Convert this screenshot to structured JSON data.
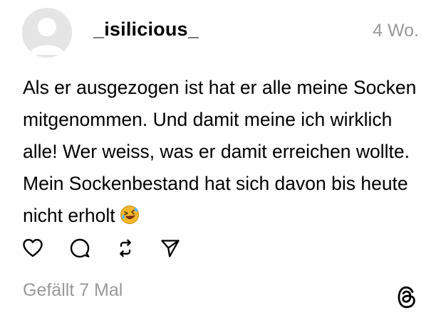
{
  "post": {
    "username": "_isilicious_",
    "time": "4 Wo.",
    "text": "Als er ausgezogen ist hat er alle meine Socken mitgenommen. Und damit meine ich wirklich alle! Wer weiss, was er damit erreichen wollte. Mein Sockenbestand hat sich davon bis heute nicht erholt",
    "emoji_icon": "rolling-on-floor-laughing-emoji",
    "likes": "Gefällt 7 Mal"
  },
  "actions": {
    "icons": [
      "heart-icon",
      "comment-icon",
      "repost-icon",
      "share-icon"
    ]
  },
  "brand": {
    "logo": "threads-logo-icon",
    "emoji_face_color": "#f5b72c",
    "muted_text_color": "#999999"
  }
}
